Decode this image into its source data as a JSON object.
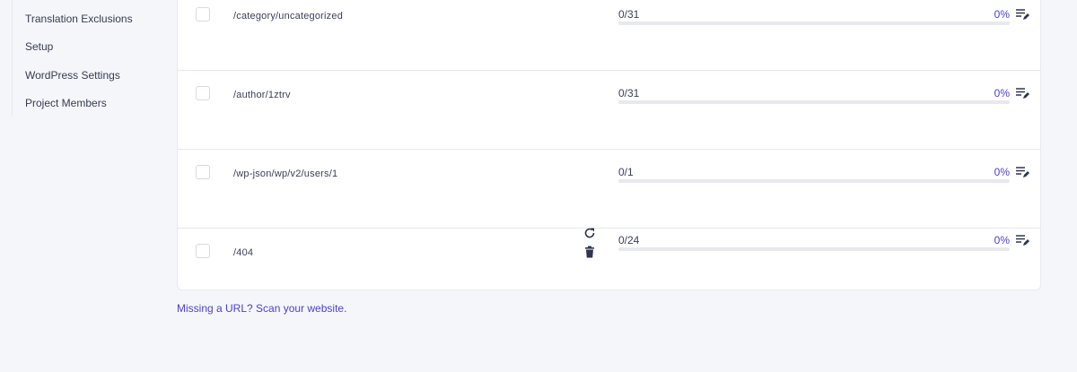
{
  "sidebar": {
    "items": [
      {
        "label": "Translation Exclusions"
      },
      {
        "label": "Setup"
      },
      {
        "label": "WordPress Settings"
      },
      {
        "label": "Project Members"
      }
    ]
  },
  "rows": [
    {
      "url": "/category/uncategorized",
      "count": "0/31",
      "percent": "0%",
      "progress": 0
    },
    {
      "url": "/author/1ztrv",
      "count": "0/31",
      "percent": "0%",
      "progress": 0
    },
    {
      "url": "/wp-json/wp/v2/users/1",
      "count": "0/1",
      "percent": "0%",
      "progress": 0
    },
    {
      "url": "/404",
      "count": "0/24",
      "percent": "0%",
      "progress": 0
    }
  ],
  "footer": {
    "scan_link": "Missing a URL? Scan your website."
  },
  "icons": {
    "row_edit": "edit-list-icon",
    "refresh": "refresh-icon",
    "delete": "trash-icon"
  },
  "colors": {
    "accent": "#4b3fd6",
    "background": "#f5f6fa",
    "panel": "#ffffff"
  }
}
